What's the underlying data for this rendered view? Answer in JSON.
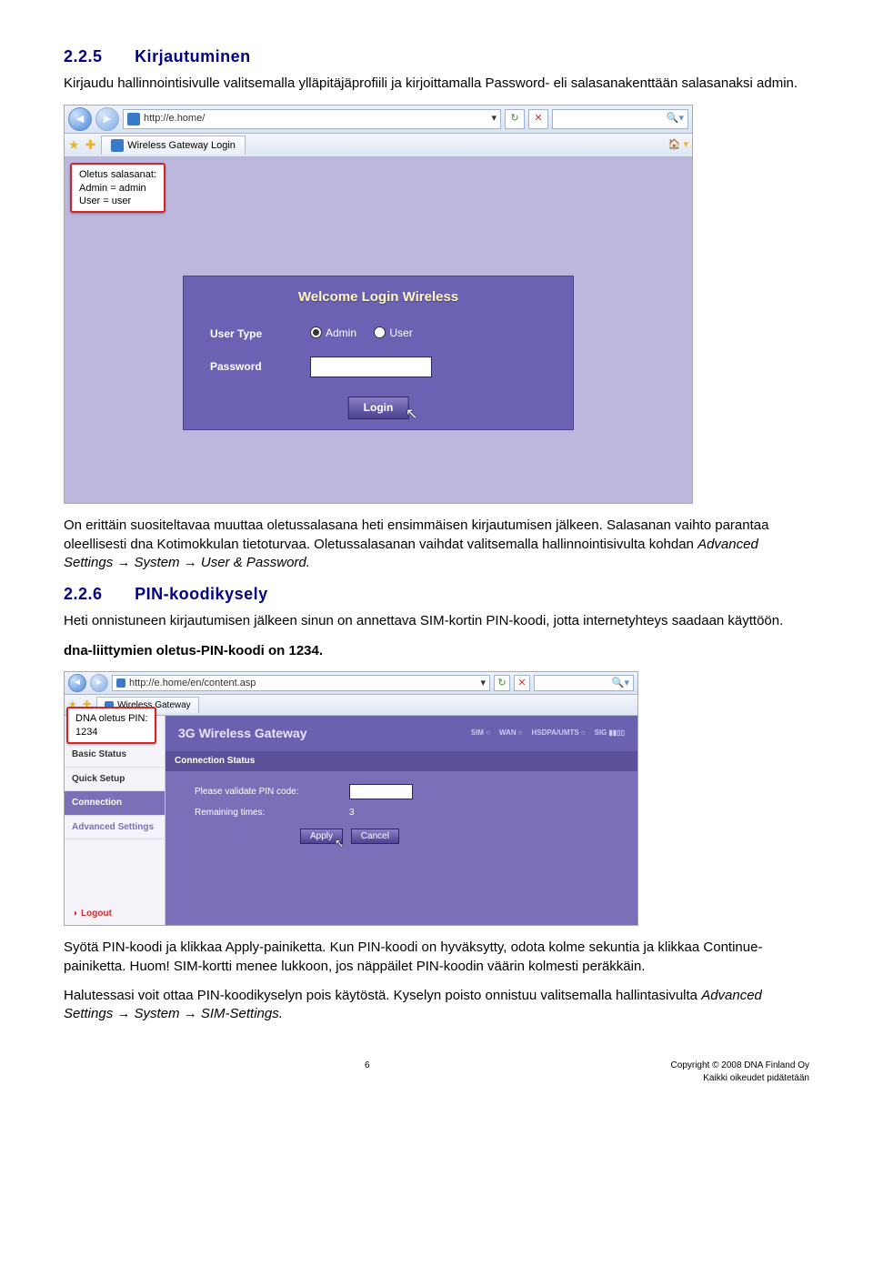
{
  "sec225": {
    "num": "2.2.5",
    "title": "Kirjautuminen",
    "p1": "Kirjaudu hallinnointisivulle valitsemalla ylläpitäjäprofiili ja kirjoittamalla Password- eli salasanakenttään salasanaksi admin."
  },
  "shot1": {
    "url": "http://e.home/",
    "tab": "Wireless Gateway Login",
    "tip_title": "Oletus salasanat:",
    "tip_l1": "Admin = admin",
    "tip_l2": "User = user",
    "card_title": "Welcome Login Wireless",
    "lbl_user": "User Type",
    "radio_admin": "Admin",
    "radio_user": "User",
    "lbl_pw": "Password",
    "pw_value": "•••••",
    "login": "Login"
  },
  "mid": {
    "p1": "On erittäin suositeltavaa muuttaa oletussalasana heti ensimmäisen kirjautumisen jälkeen. Salasanan vaihto parantaa oleellisesti dna Kotimokkulan tietoturvaa. Oletussalasanan vaihdat valitsemalla hallinnointisivulta kohdan ",
    "p1_it": "Advanced Settings → System → User & Password."
  },
  "sec226": {
    "num": "2.2.6",
    "title": "PIN-koodikysely",
    "p1": "Heti onnistuneen kirjautumisen jälkeen sinun on annettava SIM-kortin PIN-koodi, jotta internetyhteys saadaan käyttöön.",
    "p2": "dna-liittymien oletus-PIN-koodi on 1234."
  },
  "shot2": {
    "url": "http://e.home/en/content.asp",
    "tab": "Wireless Gateway",
    "tip_title": "DNA oletus PIN:",
    "tip_l1": "1234",
    "brand": "3G Wireless Gateway",
    "sig": {
      "a": "SIM",
      "b": "WAN",
      "c": "HSDPA/UMTS",
      "d": "SIG"
    },
    "side": {
      "basic": "Basic Status",
      "quick": "Quick Setup",
      "conn": "Connection",
      "adv": "Advanced Settings",
      "logout": "Logout"
    },
    "panel_title": "Connection Status",
    "row1": "Please validate PIN code:",
    "pin_value": "•••",
    "row2": "Remaining times:",
    "remaining": "3",
    "apply": "Apply",
    "cancel": "Cancel"
  },
  "tail": {
    "p1a": "Syötä PIN-koodi ja klikkaa Apply-painiketta. Kun PIN-koodi on hyväksytty, odota kolme sekuntia ja klikkaa Continue-painiketta. Huom! SIM-kortti menee lukkoon, jos näppäilet PIN-koodin väärin kolmesti peräkkäin.",
    "p2a": "Halutessasi voit ottaa PIN-koodikyselyn pois käytöstä. Kyselyn poisto onnistuu valitsemalla hallintasivulta ",
    "p2it": "Advanced Settings → System → SIM-Settings."
  },
  "footer": {
    "page": "6",
    "c1": "Copyright © 2008 DNA Finland Oy",
    "c2": "Kaikki oikeudet pidätetään"
  }
}
